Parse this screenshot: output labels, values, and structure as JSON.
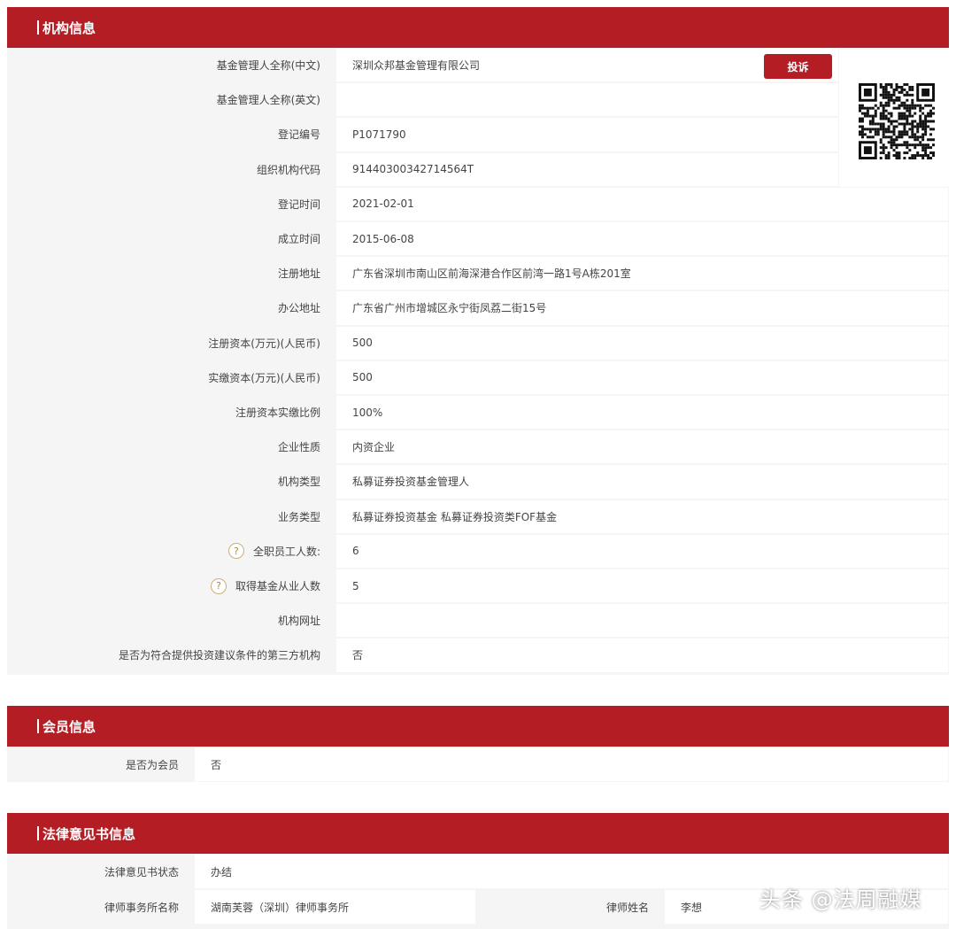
{
  "institution": {
    "header": "机构信息",
    "complain_label": "投诉",
    "rows": [
      {
        "label": "基金管理人全称(中文)",
        "value": "深圳众邦基金管理有限公司"
      },
      {
        "label": "基金管理人全称(英文)",
        "value": ""
      },
      {
        "label": "登记编号",
        "value": "P1071790"
      },
      {
        "label": "组织机构代码",
        "value": "91440300342714564T"
      },
      {
        "label": "登记时间",
        "value": "2021-02-01"
      },
      {
        "label": "成立时间",
        "value": "2015-06-08"
      },
      {
        "label": "注册地址",
        "value": "广东省深圳市南山区前海深港合作区前湾一路1号A栋201室"
      },
      {
        "label": "办公地址",
        "value": "广东省广州市增城区永宁街凤荔二街15号"
      },
      {
        "label": "注册资本(万元)(人民币)",
        "value": "500"
      },
      {
        "label": "实缴资本(万元)(人民币)",
        "value": "500"
      },
      {
        "label": "注册资本实缴比例",
        "value": "100%"
      },
      {
        "label": "企业性质",
        "value": "内资企业"
      },
      {
        "label": "机构类型",
        "value": "私募证券投资基金管理人"
      },
      {
        "label": "业务类型",
        "value": "私募证券投资基金  私募证券投资类FOF基金"
      },
      {
        "label": "全职员工人数:",
        "value": "6",
        "help": true
      },
      {
        "label": "取得基金从业人数",
        "value": "5",
        "help": true
      },
      {
        "label": "机构网址",
        "value": ""
      },
      {
        "label": "是否为符合提供投资建议条件的第三方机构",
        "value": "否"
      }
    ]
  },
  "member": {
    "header": "会员信息",
    "rows": [
      {
        "label": "是否为会员",
        "value": "否"
      }
    ]
  },
  "legal": {
    "header": "法律意见书信息",
    "status_label": "法律意见书状态",
    "status_value": "办结",
    "firm_label": "律师事务所名称",
    "firm_value": "湖南芙蓉（深圳）律师事务所",
    "lawyer_label": "律师姓名",
    "lawyer_value": "李想"
  },
  "icons": {
    "help": "question-circle-icon",
    "qr": "qr-code-icon"
  },
  "colors": {
    "accent": "#b51d25",
    "label_bg": "#f5f5f5",
    "value_bg": "#ffffff"
  },
  "watermark": "头条 @法周融媒"
}
